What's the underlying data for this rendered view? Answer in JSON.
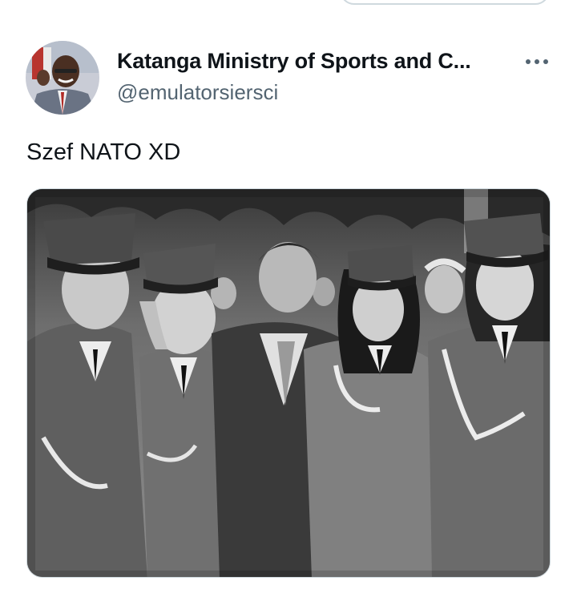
{
  "top": {
    "pill_button_label": ""
  },
  "tweet": {
    "author": {
      "display_name": "Katanga Ministry of Sports and C...",
      "handle": "@emulatorsiersci",
      "avatar_icon": "profile-photo"
    },
    "more_icon": "more-horizontal-icon",
    "text": "Szef NATO XD",
    "media": {
      "type": "photo",
      "style": "black-and-white"
    }
  },
  "colors": {
    "text_primary": "#0f1419",
    "text_secondary": "#536471",
    "border": "#cfd9de",
    "background": "#ffffff"
  }
}
